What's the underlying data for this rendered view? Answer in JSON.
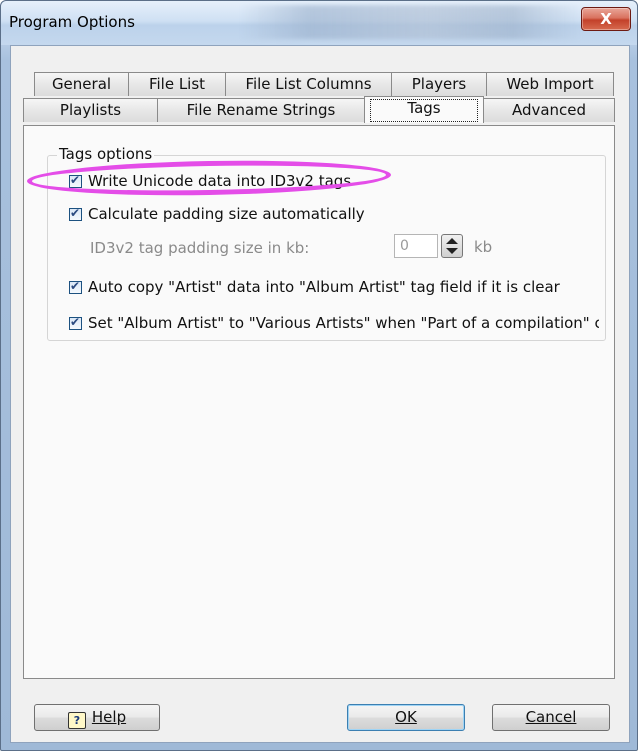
{
  "window": {
    "title": "Program Options",
    "close_symbol": "X"
  },
  "tabs_row1": [
    {
      "label": "General"
    },
    {
      "label": "File List"
    },
    {
      "label": "File List Columns"
    },
    {
      "label": "Players"
    },
    {
      "label": "Web Import"
    }
  ],
  "tabs_row2": [
    {
      "label": "Playlists"
    },
    {
      "label": "File Rename Strings"
    },
    {
      "label": "Tags",
      "active": true
    },
    {
      "label": "Advanced"
    }
  ],
  "group": {
    "title": "Tags options",
    "write_unicode": {
      "label": "Write Unicode data into ID3v2 tags",
      "checked": true
    },
    "calc_padding": {
      "label": "Calculate padding size automatically",
      "checked": true
    },
    "padding_size": {
      "label": "ID3v2 tag padding size in kb:",
      "value": "0",
      "unit": "kb",
      "disabled": true
    },
    "auto_copy": {
      "label": "Auto copy \"Artist\" data into \"Album Artist\" tag field if it is clear",
      "checked": true
    },
    "various_artists": {
      "label": "Set \"Album Artist\" to \"Various Artists\" when \"Part of a compilation\" ch",
      "checked": true
    }
  },
  "buttons": {
    "help": {
      "label": "Help",
      "icon_text": "?",
      "icon": "help-icon"
    },
    "ok": {
      "label": "OK"
    },
    "cancel": {
      "label": "Cancel"
    }
  },
  "colors": {
    "highlight": "#e44de8",
    "close_button": "#c3412a"
  }
}
